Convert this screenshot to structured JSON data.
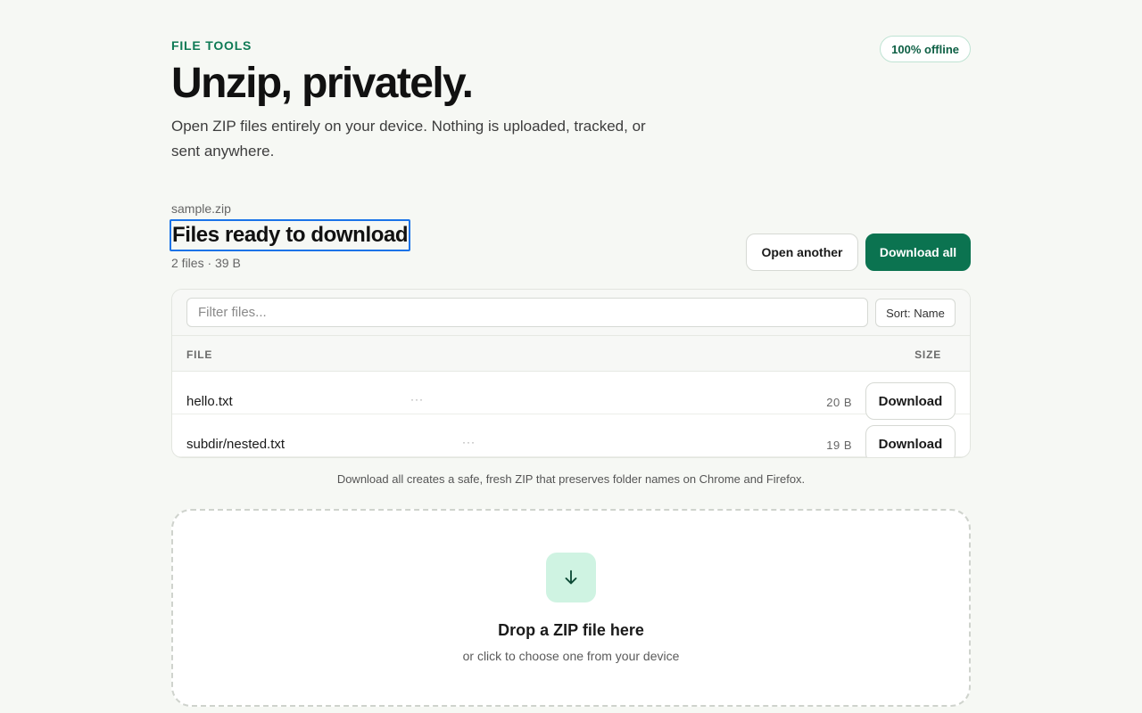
{
  "header": {
    "eyebrow": "FILE TOOLS",
    "badge": "100% offline",
    "title": "Unzip, privately.",
    "subtitle": "Open ZIP files entirely on your device. Nothing is uploaded, tracked, or sent anywhere."
  },
  "archive": {
    "filename": "sample.zip",
    "heading": "Files ready to download",
    "meta": "2 files · 39 B",
    "open_another_label": "Open another",
    "download_all_label": "Download all"
  },
  "table": {
    "filter_placeholder": "Filter files...",
    "sort_label": "Sort: Name",
    "columns": {
      "file": "FILE",
      "size": "SIZE"
    },
    "rows": [
      {
        "name": "hello.txt",
        "more": "···",
        "size": "20 B",
        "action": "Download"
      },
      {
        "name": "subdir/nested.txt",
        "more": "···",
        "size": "19 B",
        "action": "Download"
      }
    ]
  },
  "note": "Download all creates a safe, fresh ZIP that preserves folder names on Chrome and Firefox.",
  "dropzone": {
    "icon": "arrow-down-icon",
    "title": "Drop a ZIP file here",
    "subtitle": "or click to choose one from your device"
  },
  "colors": {
    "accent": "#0b7350",
    "accent_light": "#cff3e2",
    "background": "#f6f8f4",
    "focus_ring": "#1a73e8"
  }
}
